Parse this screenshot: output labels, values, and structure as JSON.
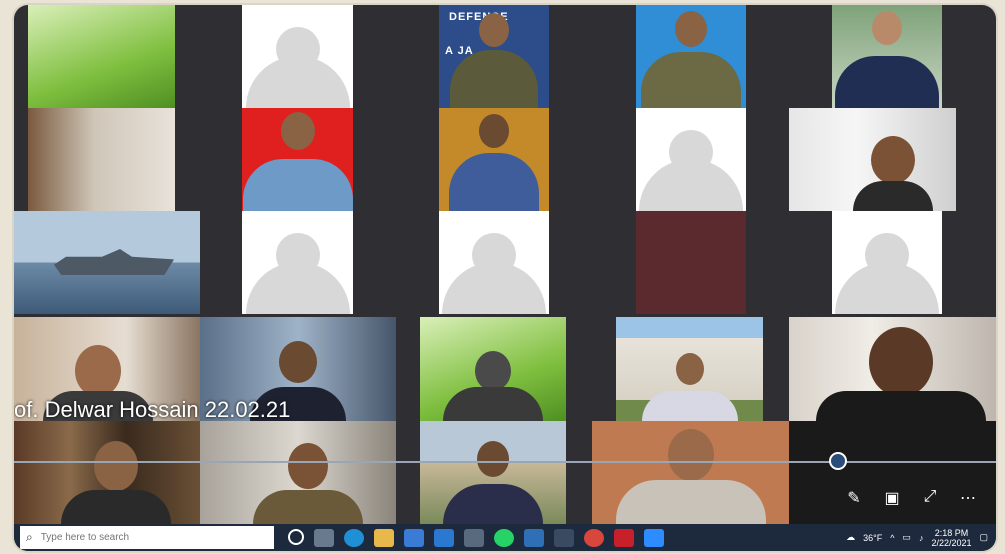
{
  "meeting": {
    "caption": "of. Delwar Hossain 22.02.21",
    "banner_fragment": "DEFENCE",
    "banner_fragment2": "A JA"
  },
  "controls": [
    {
      "name": "pen-icon",
      "glyph": "✎"
    },
    {
      "name": "screen-icon",
      "glyph": "▣"
    },
    {
      "name": "expand-icon",
      "glyph": "⤢"
    },
    {
      "name": "more-icon",
      "glyph": "⋯"
    }
  ],
  "taskbar": {
    "search_placeholder": "Type here to search",
    "tray_temp": "36°F",
    "clock_time": "2:18 PM",
    "clock_date": "2/22/2021"
  },
  "colors": {
    "taskbar": "#1d2a3d",
    "frame": "#2f2f33",
    "accent": "#2a4d7a"
  }
}
